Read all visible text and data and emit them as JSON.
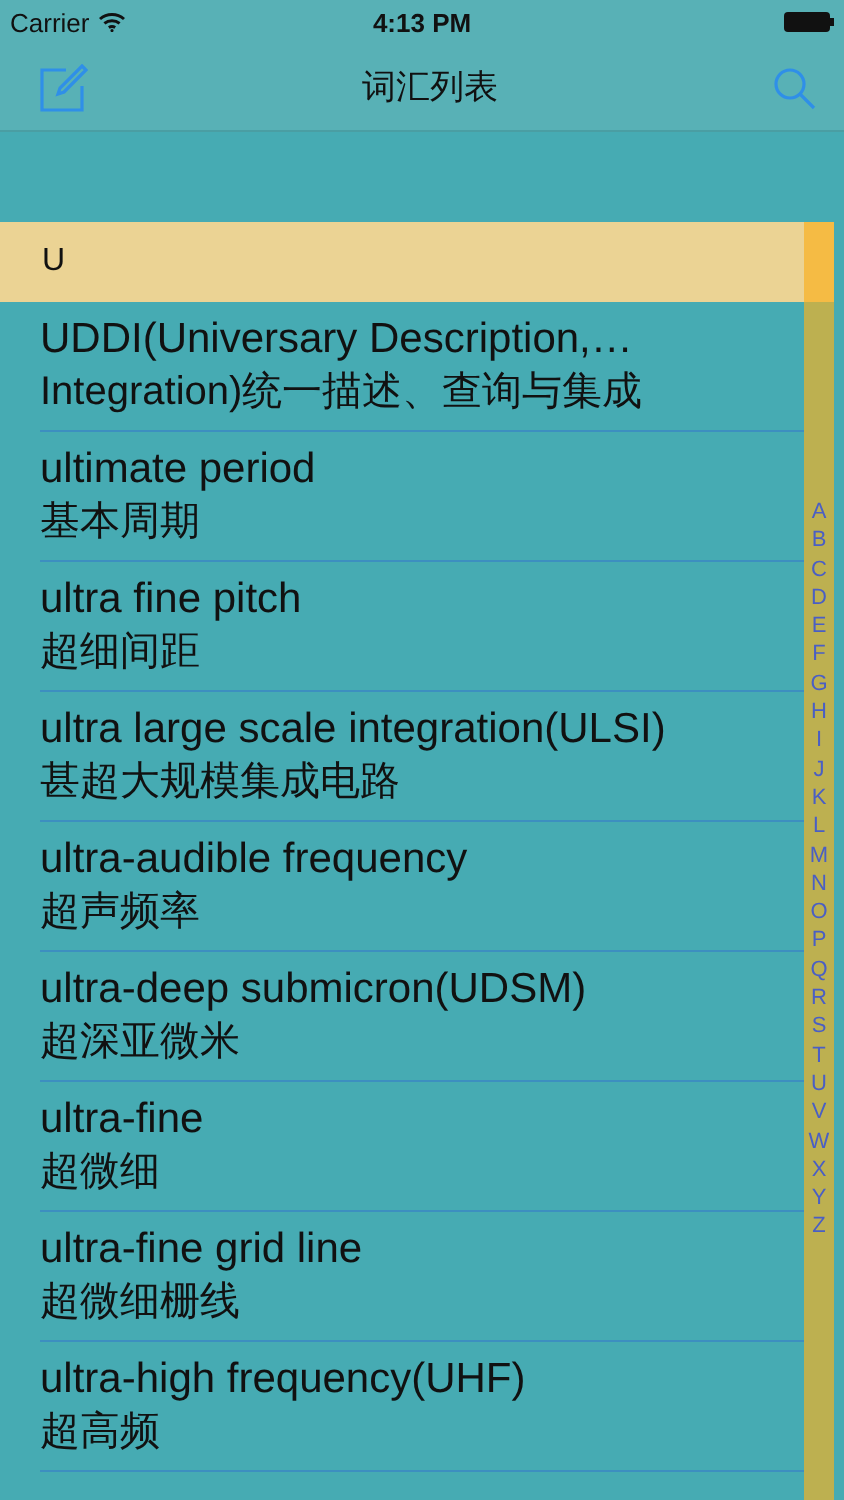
{
  "status_bar": {
    "carrier": "Carrier",
    "time": "4:13 PM"
  },
  "nav_bar": {
    "title": "词汇列表"
  },
  "section": {
    "title": "U"
  },
  "rows": [
    {
      "term": "UDDI(Universary Description,…",
      "translation": "Integration)统一描述、查询与集成"
    },
    {
      "term": "ultimate period",
      "translation": "基本周期"
    },
    {
      "term": "ultra fine pitch",
      "translation": "超细间距"
    },
    {
      "term": "ultra large scale integration(ULSI)",
      "translation": "甚超大规模集成电路"
    },
    {
      "term": "ultra-audible frequency",
      "translation": "超声频率"
    },
    {
      "term": "ultra-deep submicron(UDSM)",
      "translation": "超深亚微米"
    },
    {
      "term": "ultra-fine",
      "translation": "超微细"
    },
    {
      "term": "ultra-fine grid line",
      "translation": "超微细栅线"
    },
    {
      "term": "ultra-high frequency(UHF)",
      "translation": "超高频"
    }
  ],
  "index": [
    "A",
    "B",
    "C",
    "D",
    "E",
    "F",
    "G",
    "H",
    "I",
    "J",
    "K",
    "L",
    "M",
    "N",
    "O",
    "P",
    "Q",
    "R",
    "S",
    "T",
    "U",
    "V",
    "W",
    "X",
    "Y",
    "Z"
  ]
}
